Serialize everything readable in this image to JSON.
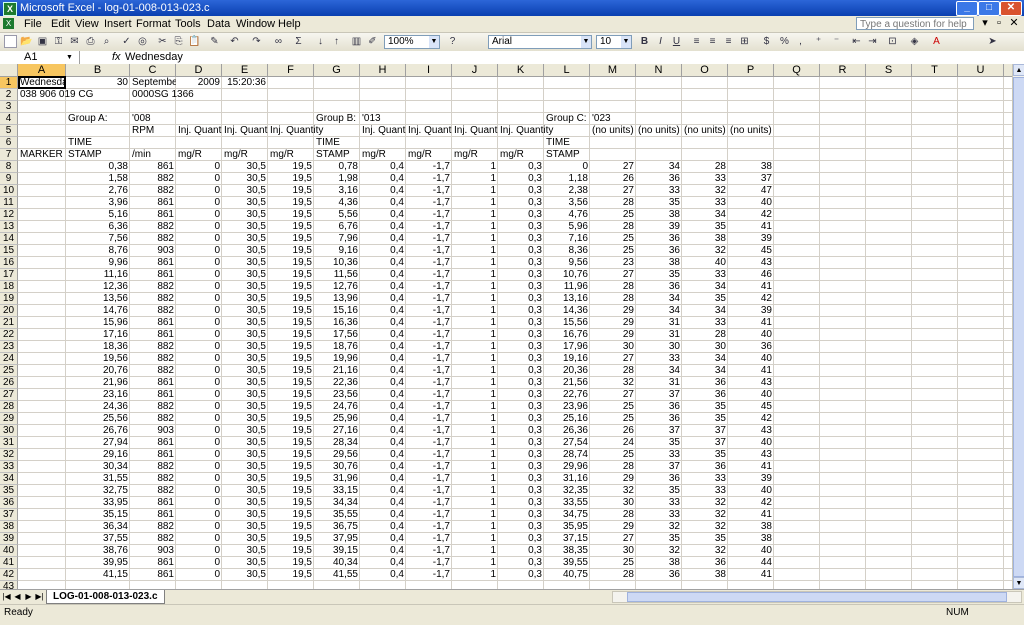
{
  "window": {
    "title": "Microsoft Excel - log-01-008-013-023.c"
  },
  "menu": {
    "items": [
      "File",
      "Edit",
      "View",
      "Insert",
      "Format",
      "Tools",
      "Data",
      "Window",
      "Help"
    ],
    "help_placeholder": "Type a question for help"
  },
  "toolbar": {
    "zoom": "100%",
    "font": "Arial",
    "font_size": "10"
  },
  "formula_bar": {
    "name_box": "A1",
    "fx": "fx",
    "value": "Wednesday"
  },
  "columns": [
    "A",
    "B",
    "C",
    "D",
    "E",
    "F",
    "G",
    "H",
    "I",
    "J",
    "K",
    "L",
    "M",
    "N",
    "O",
    "P",
    "Q",
    "R",
    "S",
    "T",
    "U",
    "V"
  ],
  "header_rows": [
    {
      "row": "1",
      "A": "Wednesday",
      "B": "30",
      "C": "September",
      "D": "2009",
      "E": "15:20:36"
    },
    {
      "row": "2",
      "A": "038 906 019 CG",
      "C": "0000SG 1366"
    },
    {
      "row": "3"
    },
    {
      "row": "4",
      "B": "Group A:",
      "C": "'008",
      "G": "Group B:",
      "H": "'013",
      "L": "Group C:",
      "M": "'023"
    },
    {
      "row": "5",
      "C": "RPM",
      "D": "Inj. Quantity",
      "E": "Inj. Quantity",
      "F": "Inj. Quantity",
      "H": "Inj. Quantity",
      "I": "Inj. Quantity",
      "J": "Inj. Quantity",
      "K": "Inj. Quantity",
      "M": "(no units)",
      "N": "(no units)",
      "O": "(no units)",
      "P": "(no units)"
    },
    {
      "row": "6",
      "B": "TIME",
      "G": "TIME",
      "L": "TIME"
    },
    {
      "row": "7",
      "A": "MARKER",
      "B": "STAMP",
      "C": "/min",
      "D": "mg/R",
      "E": "mg/R",
      "F": "mg/R",
      "G": "STAMP",
      "H": "mg/R",
      "I": "mg/R",
      "J": "mg/R",
      "K": "mg/R",
      "L": "STAMP"
    }
  ],
  "data_rows": [
    [
      "8",
      "0,38",
      "861",
      "0",
      "30,5",
      "19,5",
      "0,78",
      "0,4",
      "-1,7",
      "1",
      "0,3",
      "0",
      "27",
      "34",
      "28",
      "38"
    ],
    [
      "9",
      "1,58",
      "882",
      "0",
      "30,5",
      "19,5",
      "1,98",
      "0,4",
      "-1,7",
      "1",
      "0,3",
      "1,18",
      "26",
      "36",
      "33",
      "37"
    ],
    [
      "10",
      "2,76",
      "882",
      "0",
      "30,5",
      "19,5",
      "3,16",
      "0,4",
      "-1,7",
      "1",
      "0,3",
      "2,38",
      "27",
      "33",
      "32",
      "47"
    ],
    [
      "11",
      "3,96",
      "861",
      "0",
      "30,5",
      "19,5",
      "4,36",
      "0,4",
      "-1,7",
      "1",
      "0,3",
      "3,56",
      "28",
      "35",
      "33",
      "40"
    ],
    [
      "12",
      "5,16",
      "861",
      "0",
      "30,5",
      "19,5",
      "5,56",
      "0,4",
      "-1,7",
      "1",
      "0,3",
      "4,76",
      "25",
      "38",
      "34",
      "42"
    ],
    [
      "13",
      "6,36",
      "882",
      "0",
      "30,5",
      "19,5",
      "6,76",
      "0,4",
      "-1,7",
      "1",
      "0,3",
      "5,96",
      "28",
      "39",
      "35",
      "41"
    ],
    [
      "14",
      "7,56",
      "882",
      "0",
      "30,5",
      "19,5",
      "7,96",
      "0,4",
      "-1,7",
      "1",
      "0,3",
      "7,16",
      "25",
      "36",
      "38",
      "39"
    ],
    [
      "15",
      "8,76",
      "903",
      "0",
      "30,5",
      "19,5",
      "9,16",
      "0,4",
      "-1,7",
      "1",
      "0,3",
      "8,36",
      "25",
      "36",
      "32",
      "45"
    ],
    [
      "16",
      "9,96",
      "861",
      "0",
      "30,5",
      "19,5",
      "10,36",
      "0,4",
      "-1,7",
      "1",
      "0,3",
      "9,56",
      "23",
      "38",
      "40",
      "43"
    ],
    [
      "17",
      "11,16",
      "861",
      "0",
      "30,5",
      "19,5",
      "11,56",
      "0,4",
      "-1,7",
      "1",
      "0,3",
      "10,76",
      "27",
      "35",
      "33",
      "46"
    ],
    [
      "18",
      "12,36",
      "882",
      "0",
      "30,5",
      "19,5",
      "12,76",
      "0,4",
      "-1,7",
      "1",
      "0,3",
      "11,96",
      "28",
      "36",
      "34",
      "41"
    ],
    [
      "19",
      "13,56",
      "882",
      "0",
      "30,5",
      "19,5",
      "13,96",
      "0,4",
      "-1,7",
      "1",
      "0,3",
      "13,16",
      "28",
      "34",
      "35",
      "42"
    ],
    [
      "20",
      "14,76",
      "882",
      "0",
      "30,5",
      "19,5",
      "15,16",
      "0,4",
      "-1,7",
      "1",
      "0,3",
      "14,36",
      "29",
      "34",
      "34",
      "39"
    ],
    [
      "21",
      "15,96",
      "861",
      "0",
      "30,5",
      "19,5",
      "16,36",
      "0,4",
      "-1,7",
      "1",
      "0,3",
      "15,56",
      "29",
      "31",
      "33",
      "41"
    ],
    [
      "22",
      "17,16",
      "861",
      "0",
      "30,5",
      "19,5",
      "17,56",
      "0,4",
      "-1,7",
      "1",
      "0,3",
      "16,76",
      "29",
      "31",
      "28",
      "40"
    ],
    [
      "23",
      "18,36",
      "882",
      "0",
      "30,5",
      "19,5",
      "18,76",
      "0,4",
      "-1,7",
      "1",
      "0,3",
      "17,96",
      "30",
      "30",
      "30",
      "36"
    ],
    [
      "24",
      "19,56",
      "882",
      "0",
      "30,5",
      "19,5",
      "19,96",
      "0,4",
      "-1,7",
      "1",
      "0,3",
      "19,16",
      "27",
      "33",
      "34",
      "40"
    ],
    [
      "25",
      "20,76",
      "882",
      "0",
      "30,5",
      "19,5",
      "21,16",
      "0,4",
      "-1,7",
      "1",
      "0,3",
      "20,36",
      "28",
      "34",
      "34",
      "41"
    ],
    [
      "26",
      "21,96",
      "861",
      "0",
      "30,5",
      "19,5",
      "22,36",
      "0,4",
      "-1,7",
      "1",
      "0,3",
      "21,56",
      "32",
      "31",
      "36",
      "43"
    ],
    [
      "27",
      "23,16",
      "861",
      "0",
      "30,5",
      "19,5",
      "23,56",
      "0,4",
      "-1,7",
      "1",
      "0,3",
      "22,76",
      "27",
      "37",
      "36",
      "40"
    ],
    [
      "28",
      "24,36",
      "882",
      "0",
      "30,5",
      "19,5",
      "24,76",
      "0,4",
      "-1,7",
      "1",
      "0,3",
      "23,96",
      "25",
      "36",
      "35",
      "45"
    ],
    [
      "29",
      "25,56",
      "882",
      "0",
      "30,5",
      "19,5",
      "25,96",
      "0,4",
      "-1,7",
      "1",
      "0,3",
      "25,16",
      "25",
      "36",
      "35",
      "42"
    ],
    [
      "30",
      "26,76",
      "903",
      "0",
      "30,5",
      "19,5",
      "27,16",
      "0,4",
      "-1,7",
      "1",
      "0,3",
      "26,36",
      "26",
      "37",
      "37",
      "43"
    ],
    [
      "31",
      "27,94",
      "861",
      "0",
      "30,5",
      "19,5",
      "28,34",
      "0,4",
      "-1,7",
      "1",
      "0,3",
      "27,54",
      "24",
      "35",
      "37",
      "40"
    ],
    [
      "32",
      "29,16",
      "861",
      "0",
      "30,5",
      "19,5",
      "29,56",
      "0,4",
      "-1,7",
      "1",
      "0,3",
      "28,74",
      "25",
      "33",
      "35",
      "43"
    ],
    [
      "33",
      "30,34",
      "882",
      "0",
      "30,5",
      "19,5",
      "30,76",
      "0,4",
      "-1,7",
      "1",
      "0,3",
      "29,96",
      "28",
      "37",
      "36",
      "41"
    ],
    [
      "34",
      "31,55",
      "882",
      "0",
      "30,5",
      "19,5",
      "31,96",
      "0,4",
      "-1,7",
      "1",
      "0,3",
      "31,16",
      "29",
      "36",
      "33",
      "39"
    ],
    [
      "35",
      "32,75",
      "882",
      "0",
      "30,5",
      "19,5",
      "33,15",
      "0,4",
      "-1,7",
      "1",
      "0,3",
      "32,35",
      "32",
      "35",
      "33",
      "40"
    ],
    [
      "36",
      "33,95",
      "861",
      "0",
      "30,5",
      "19,5",
      "34,34",
      "0,4",
      "-1,7",
      "1",
      "0,3",
      "33,55",
      "30",
      "33",
      "32",
      "42"
    ],
    [
      "37",
      "35,15",
      "861",
      "0",
      "30,5",
      "19,5",
      "35,55",
      "0,4",
      "-1,7",
      "1",
      "0,3",
      "34,75",
      "28",
      "33",
      "32",
      "41"
    ],
    [
      "38",
      "36,34",
      "882",
      "0",
      "30,5",
      "19,5",
      "36,75",
      "0,4",
      "-1,7",
      "1",
      "0,3",
      "35,95",
      "29",
      "32",
      "32",
      "38"
    ],
    [
      "39",
      "37,55",
      "882",
      "0",
      "30,5",
      "19,5",
      "37,95",
      "0,4",
      "-1,7",
      "1",
      "0,3",
      "37,15",
      "27",
      "35",
      "35",
      "38"
    ],
    [
      "40",
      "38,76",
      "903",
      "0",
      "30,5",
      "19,5",
      "39,15",
      "0,4",
      "-1,7",
      "1",
      "0,3",
      "38,35",
      "30",
      "32",
      "32",
      "40"
    ],
    [
      "41",
      "39,95",
      "861",
      "0",
      "30,5",
      "19,5",
      "40,34",
      "0,4",
      "-1,7",
      "1",
      "0,3",
      "39,55",
      "25",
      "38",
      "36",
      "44"
    ],
    [
      "42",
      "41,15",
      "861",
      "0",
      "30,5",
      "19,5",
      "41,55",
      "0,4",
      "-1,7",
      "1",
      "0,3",
      "40,75",
      "28",
      "36",
      "38",
      "41"
    ]
  ],
  "trailing_row": "43",
  "sheet_tab": "LOG-01-008-013-023.c",
  "status": {
    "left": "Ready",
    "right": "NUM"
  }
}
